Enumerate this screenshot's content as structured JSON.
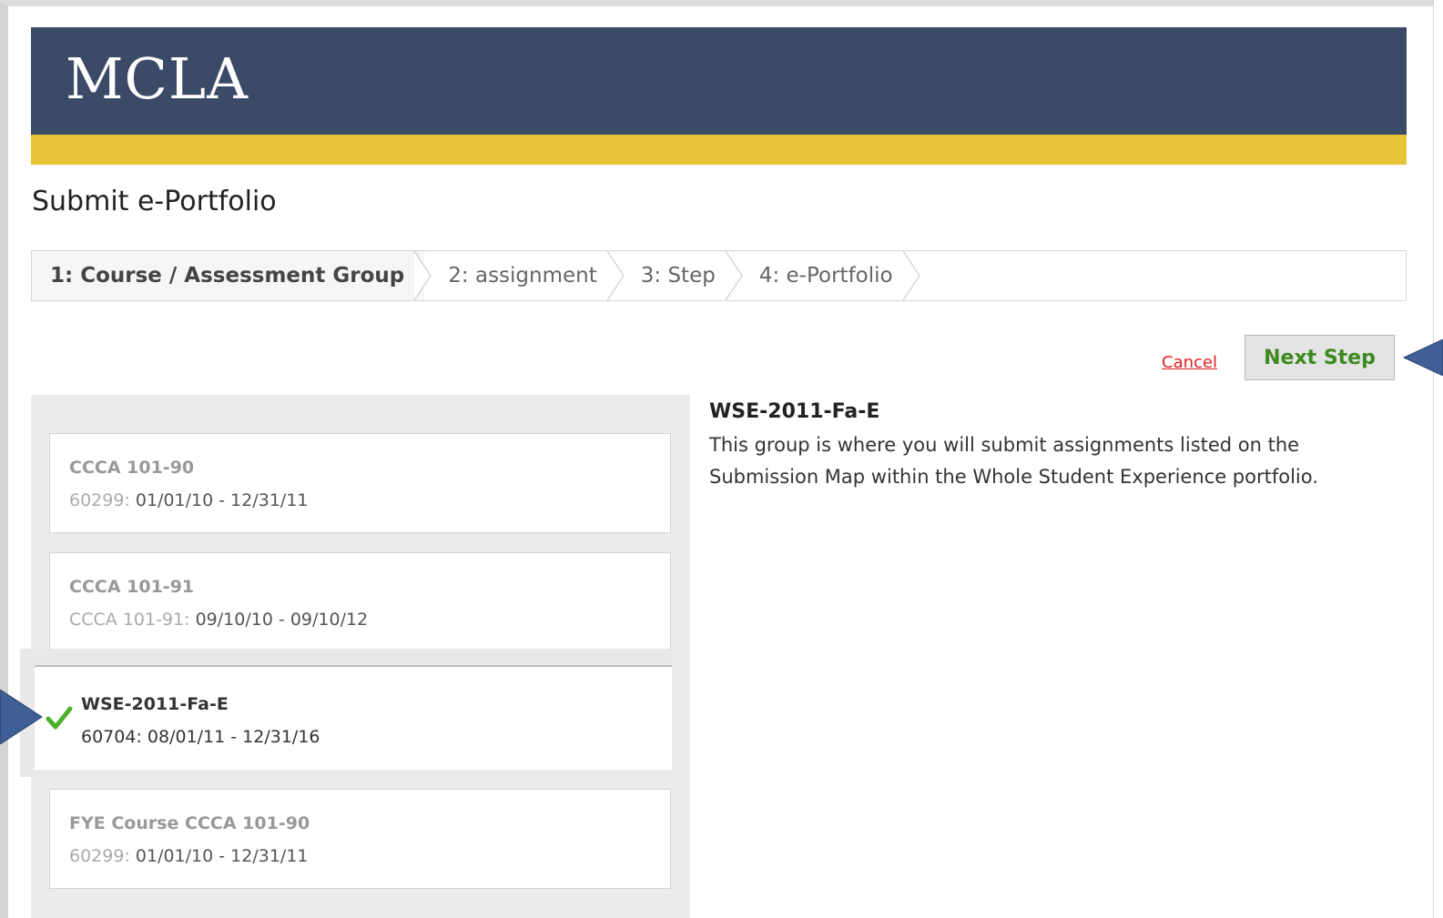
{
  "header": {
    "logo": "MCLA"
  },
  "page": {
    "title": "Submit e-Portfolio"
  },
  "wizard": {
    "steps": [
      {
        "label": "1: Course / Assessment Group",
        "active": true
      },
      {
        "label": "2: assignment",
        "active": false
      },
      {
        "label": "3: Step",
        "active": false
      },
      {
        "label": "4: e-Portfolio",
        "active": false
      }
    ]
  },
  "actions": {
    "cancel_label": "Cancel",
    "next_label": "Next Step"
  },
  "groups": [
    {
      "name": "CCCA 101-90",
      "code": "60299: ",
      "dates": "01/01/10 - 12/31/11",
      "selected": false
    },
    {
      "name": "CCCA 101-91",
      "code": "CCCA 101-91: ",
      "dates": "09/10/10 - 09/10/12",
      "selected": false
    },
    {
      "name": "WSE-2011-Fa-E",
      "code": "60704: ",
      "dates": "08/01/11 - 12/31/16",
      "selected": true
    },
    {
      "name": "FYE Course CCCA 101-90",
      "code": "60299: ",
      "dates": "01/01/10 - 12/31/11",
      "selected": false
    }
  ],
  "detail": {
    "title": "WSE-2011-Fa-E",
    "description": "This group is where you will submit assignments listed on the Submission Map within the Whole Student Experience portfolio."
  },
  "colors": {
    "banner": "#3b4a66",
    "stripe": "#e8c437",
    "next_text": "#3d8a1f",
    "cancel_text": "#e02020",
    "callout_arrow": "#3f5f96",
    "check": "#4caf2a"
  },
  "icons": {
    "selected_indicator": "checkmark-icon",
    "callout": "callout-arrow-icon"
  }
}
